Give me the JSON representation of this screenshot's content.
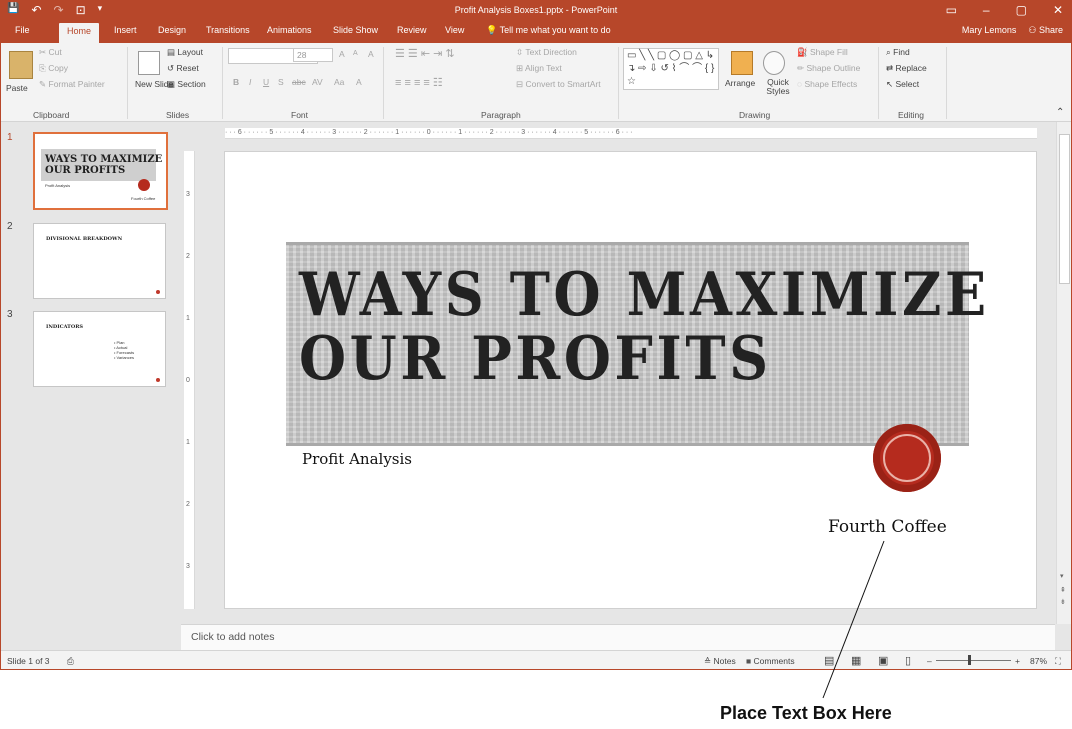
{
  "window": {
    "title": "Profit Analysis Boxes1.pptx - PowerPoint",
    "controls": [
      "▭",
      "–",
      "▢",
      "✕"
    ]
  },
  "qat": {
    "save": "💾",
    "undo": "↶",
    "redo": "↷",
    "present": "⊡",
    "more": "▾"
  },
  "tabs": [
    {
      "label": "File"
    },
    {
      "label": "Home"
    },
    {
      "label": "Insert"
    },
    {
      "label": "Design"
    },
    {
      "label": "Transitions"
    },
    {
      "label": "Animations"
    },
    {
      "label": "Slide Show"
    },
    {
      "label": "Review"
    },
    {
      "label": "View"
    }
  ],
  "tell_me": "Tell me what you want to do",
  "user": {
    "name": "Mary Lemons",
    "share": "Share"
  },
  "ribbon": {
    "clipboard": {
      "paste": "Paste",
      "cut": "Cut",
      "copy": "Copy",
      "format_painter": "Format Painter",
      "label": "Clipboard"
    },
    "slides": {
      "new_slide": "New Slide",
      "layout": "Layout",
      "reset": "Reset",
      "section": "Section",
      "label": "Slides"
    },
    "font": {
      "size": "28",
      "grow": "A",
      "shrink": "A",
      "clear": "A",
      "bold": "B",
      "italic": "I",
      "underline": "U",
      "shadow": "S",
      "strike": "abc",
      "spacing": "AV",
      "case": "Aa",
      "color": "A",
      "label": "Font"
    },
    "paragraph": {
      "text_direction": "Text Direction",
      "align_text": "Align Text",
      "convert_smartart": "Convert to SmartArt",
      "label": "Paragraph"
    },
    "drawing": {
      "arrange": "Arrange",
      "quick_styles": "Quick Styles",
      "shape_fill": "Shape Fill",
      "shape_outline": "Shape Outline",
      "shape_effects": "Shape Effects",
      "label": "Drawing",
      "shapes_glyphs": "▭ ╲ ╲ ▢ ◯ ▢ △ ↳ ↴ ⇨ ⇩ ↺ ⌇ ⌒ ⌒ { } ☆"
    },
    "editing": {
      "find": "Find",
      "replace": "Replace",
      "select": "Select",
      "label": "Editing"
    }
  },
  "thumbnails": [
    {
      "num": "1",
      "title_line1": "WAYS TO MAXIMIZE",
      "title_line2": "OUR PROFITS",
      "subtitle": "Profit Analysis",
      "company": "Fourth Coffee"
    },
    {
      "num": "2",
      "title": "DIVISIONAL BREAKDOWN"
    },
    {
      "num": "3",
      "title": "INDICATORS",
      "bullets": [
        "• Plan",
        "• Actual",
        "• Forecasts",
        "• Variances"
      ]
    }
  ],
  "ruler": {
    "h": "· · · 6 · · · · · · 5 · · · · · · 4 · · · · · · 3 · · · · · · 2 · · · · · · 1 · · · · · · 0 · · · · · · 1 · · · · · · 2 · · · · · · 3 · · · · · · 4 · · · · · · 5 · · · · · · 6 · · ·",
    "v": [
      "3",
      "2",
      "1",
      "0",
      "1",
      "2",
      "3"
    ]
  },
  "slide": {
    "title_line1": "WAYS TO MAXIMIZE",
    "title_line2": "OUR PROFITS",
    "subtitle": "Profit Analysis",
    "company": "Fourth Coffee"
  },
  "notes_placeholder": "Click to add notes",
  "status": {
    "slide_count": "Slide 1 of 3",
    "notes": "Notes",
    "comments": "Comments",
    "zoom": "87%",
    "view_icons": [
      "▤",
      "▦",
      "▣",
      "▯"
    ],
    "minus": "–",
    "plus": "+"
  },
  "annotation": "Place Text Box Here"
}
